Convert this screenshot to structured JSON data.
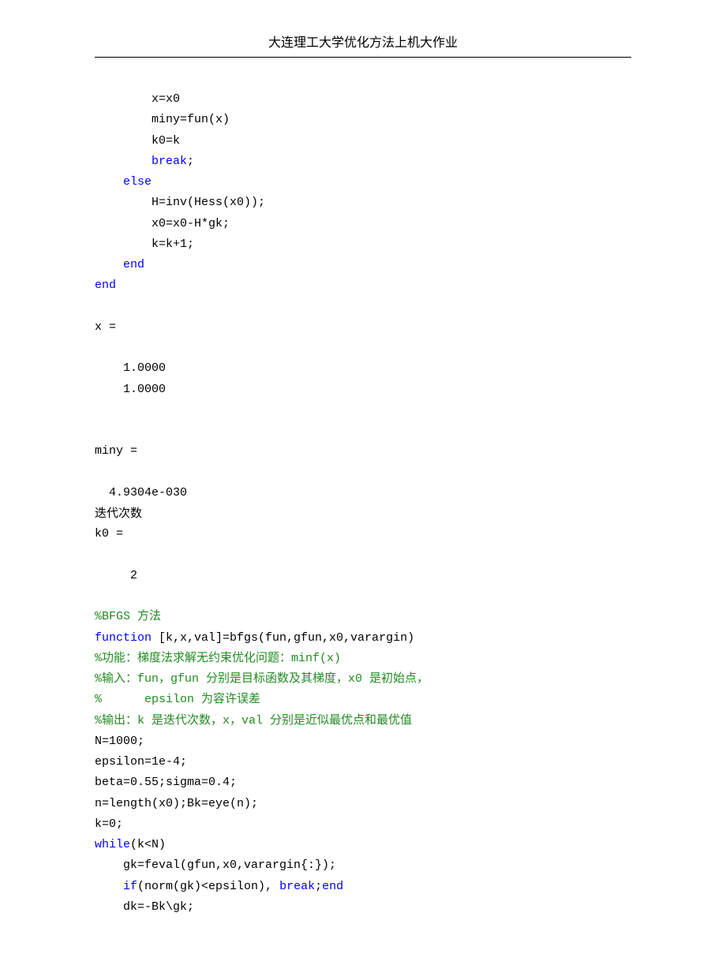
{
  "header": {
    "title": "大连理工大学优化方法上机大作业"
  },
  "code1": {
    "l1": "        x=x0",
    "l2": "        miny=fun(x)",
    "l3": "        k0=k",
    "l4a": "        ",
    "l4b": "break",
    "l4c": ";",
    "l5a": "    ",
    "l5b": "else",
    "l6": "        H=inv(Hess(x0));",
    "l7": "        x0=x0-H*gk;",
    "l8": "        k=k+1;",
    "l9a": "    ",
    "l9b": "end",
    "l10": "end"
  },
  "output": {
    "x_label": "x =",
    "x_val1": "    1.0000",
    "x_val2": "    1.0000",
    "miny_label": "miny =",
    "miny_val": "  4.9304e-030",
    "iter_text": "迭代次数",
    "k0_label": "k0 =",
    "k0_val": "     2"
  },
  "code2": {
    "c1": "%BFGS 方法",
    "l1a": "function",
    "l1b": " [k,x,val]=bfgs(fun,gfun,x0,varargin)",
    "c2": "%功能：梯度法求解无约束优化问题：minf(x)",
    "c3": "%输入：fun，gfun 分别是目标函数及其梯度，x0 是初始点，",
    "c4": "%      epsilon 为容许误差",
    "c5": "%输出：k 是迭代次数，x，val 分别是近似最优点和最优值",
    "l2": "N=1000;",
    "l3": "epsilon=1e-4;",
    "l4": "beta=0.55;sigma=0.4;",
    "l5": "n=length(x0);Bk=eye(n);",
    "l6": "k=0;",
    "l7a": "while",
    "l7b": "(k<N)",
    "l8": "    gk=feval(gfun,x0,varargin{:});",
    "l9a": "    ",
    "l9b": "if",
    "l9c": "(norm(gk)<epsilon), ",
    "l9d": "break",
    "l9e": ";",
    "l9f": "end",
    "l10": "    dk=-Bk\\gk;"
  }
}
